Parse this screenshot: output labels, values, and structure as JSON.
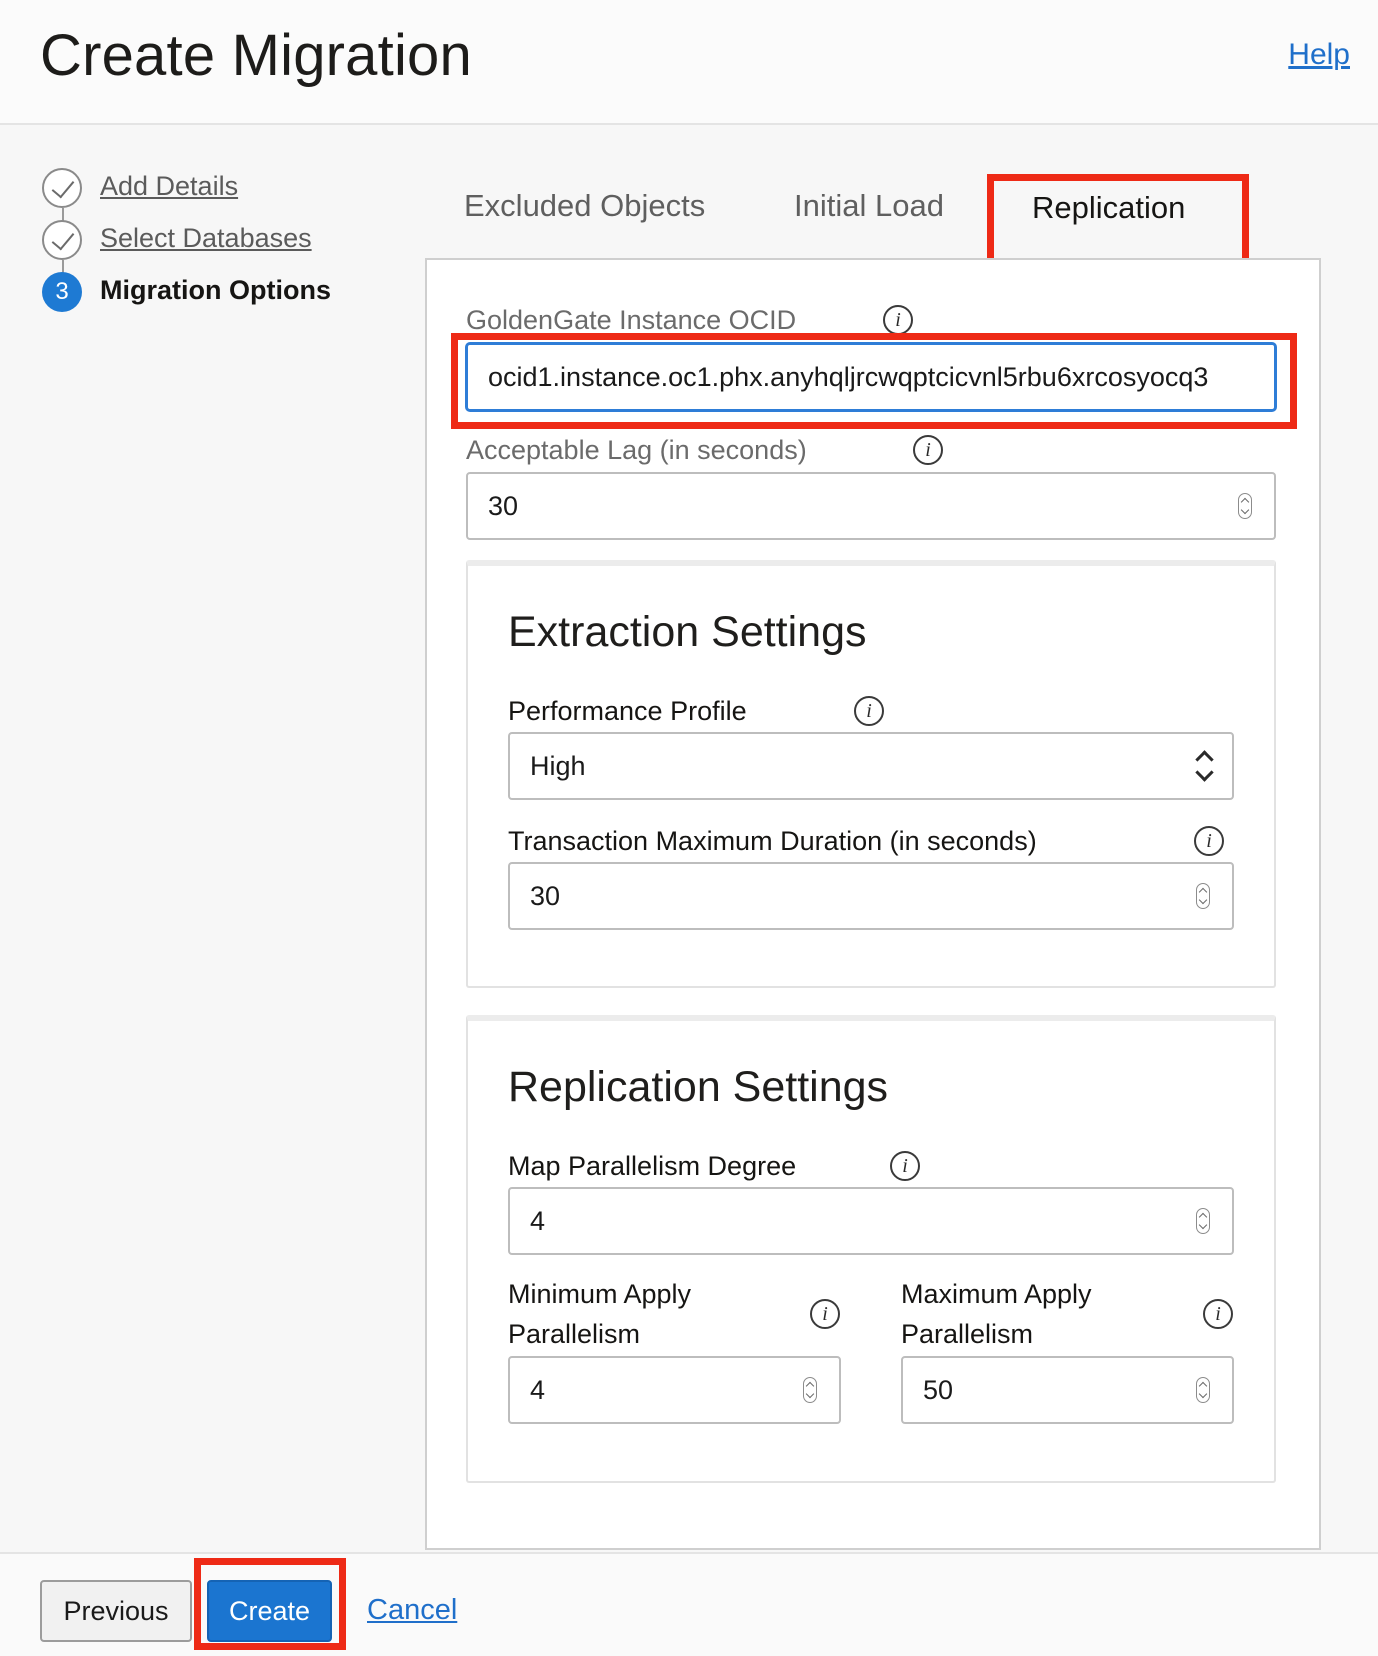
{
  "header": {
    "title": "Create Migration",
    "help_label": "Help"
  },
  "steps": [
    {
      "label": "Add Details",
      "status": "complete"
    },
    {
      "label": "Select Databases",
      "status": "complete"
    },
    {
      "label": "Migration Options",
      "status": "current",
      "number": "3"
    }
  ],
  "tabs": [
    {
      "label": "Excluded Objects",
      "active": false
    },
    {
      "label": "Initial Load",
      "active": false
    },
    {
      "label": "Replication",
      "active": true
    }
  ],
  "form": {
    "ocid": {
      "label": "GoldenGate Instance OCID",
      "value": "ocid1.instance.oc1.phx.anyhqljrcwqptcicvnl5rbu6xrcosyocq3"
    },
    "acceptable_lag": {
      "label": "Acceptable Lag (in seconds)",
      "value": "30"
    }
  },
  "extraction": {
    "title": "Extraction Settings",
    "performance_profile": {
      "label": "Performance Profile",
      "value": "High"
    },
    "txn_max_duration": {
      "label": "Transaction Maximum Duration (in seconds)",
      "value": "30"
    }
  },
  "replication": {
    "title": "Replication Settings",
    "map_parallelism": {
      "label": "Map Parallelism Degree",
      "value": "4"
    },
    "min_apply": {
      "label_line1": "Minimum Apply",
      "label_line2": "Parallelism",
      "value": "4"
    },
    "max_apply": {
      "label_line1": "Maximum Apply",
      "label_line2": "Parallelism",
      "value": "50"
    }
  },
  "footer": {
    "previous_label": "Previous",
    "create_label": "Create",
    "cancel_label": "Cancel"
  },
  "info_glyph": "i",
  "colors": {
    "accent": "#1b75d0",
    "highlight": "#ee2a16",
    "link": "#1f6fca"
  }
}
